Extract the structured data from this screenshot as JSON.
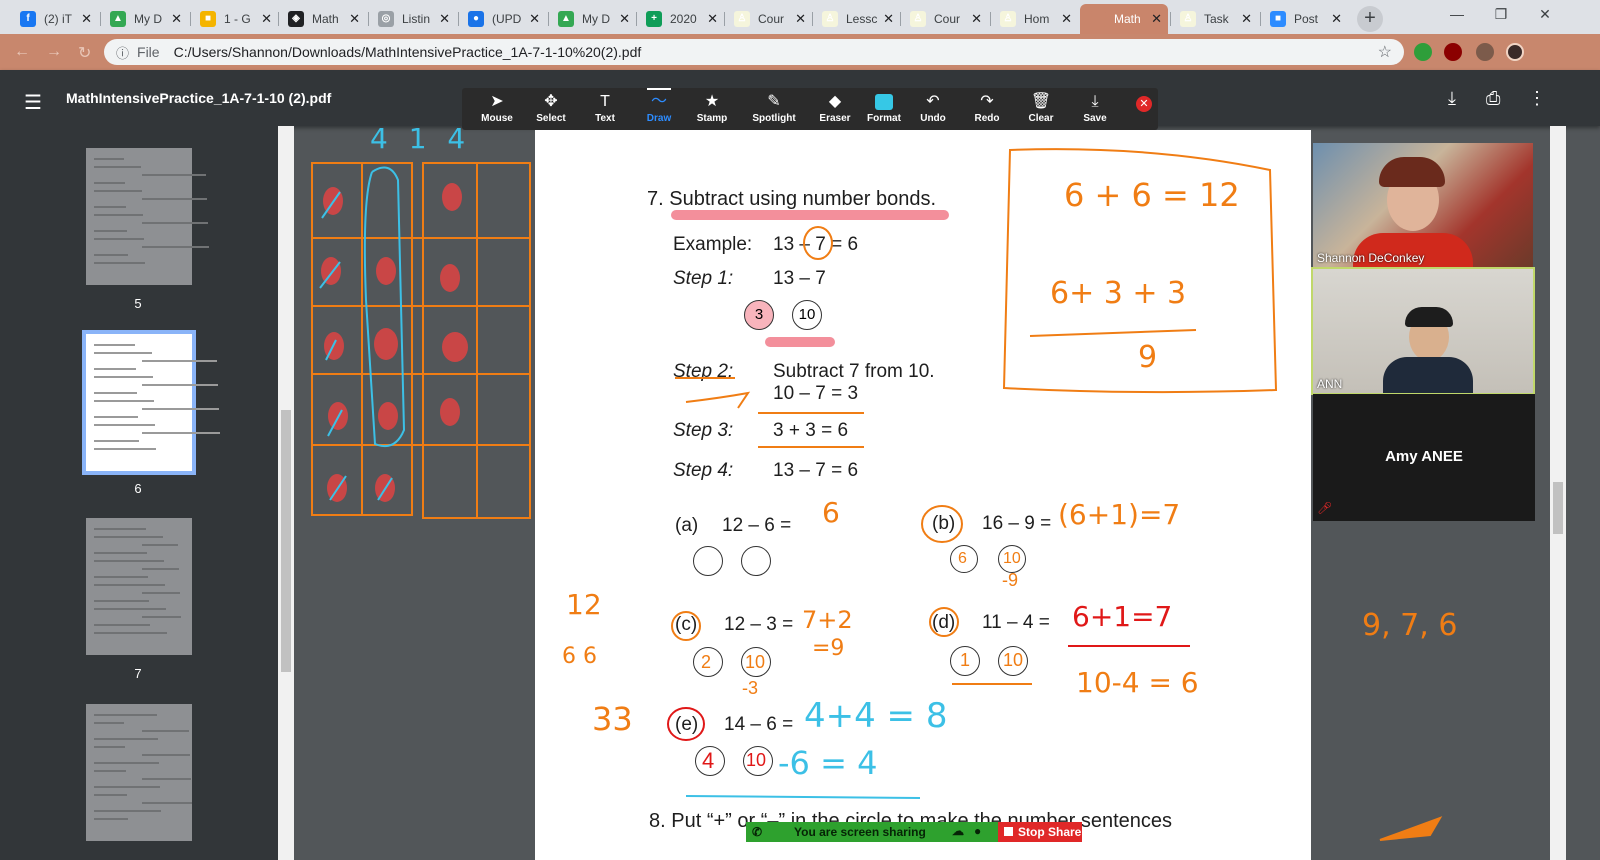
{
  "browser": {
    "tabs": [
      {
        "title": "(2) iT",
        "fav": "#1877f2",
        "glyph": "f"
      },
      {
        "title": "My D",
        "fav": "#34a853",
        "glyph": "▲"
      },
      {
        "title": "1 - G",
        "fav": "#f4b400",
        "glyph": "■"
      },
      {
        "title": "Math",
        "fav": "#202124",
        "glyph": "◈"
      },
      {
        "title": "Listin",
        "fav": "#9aa0a6",
        "glyph": "◎"
      },
      {
        "title": "(UPD",
        "fav": "#1a73e8",
        "glyph": "●"
      },
      {
        "title": "My D",
        "fav": "#34a853",
        "glyph": "▲"
      },
      {
        "title": "2020",
        "fav": "#0f9d58",
        "glyph": "+"
      },
      {
        "title": "Cour",
        "fav": "#f5f5dc",
        "glyph": "♙"
      },
      {
        "title": "Lessc",
        "fav": "#f5f5dc",
        "glyph": "♙"
      },
      {
        "title": "Cour",
        "fav": "#f5f5dc",
        "glyph": "♙"
      },
      {
        "title": "Hom",
        "fav": "#f5f5dc",
        "glyph": "♙"
      },
      {
        "title": "Math",
        "fav": "#c9856b",
        "glyph": ""
      },
      {
        "title": "Task",
        "fav": "#f5f5dc",
        "glyph": "♙"
      },
      {
        "title": "Post",
        "fav": "#2d8cff",
        "glyph": "■"
      }
    ],
    "address": {
      "scheme": "File",
      "url": "C:/Users/Shannon/Downloads/MathIntensivePractice_1A-7-1-10%20(2).pdf"
    }
  },
  "pdf": {
    "title": "MathIntensivePractice_1A-7-1-10 (2).pdf",
    "thumbs": [
      {
        "page": "5"
      },
      {
        "page": "6"
      },
      {
        "page": "7"
      },
      {
        "page": ""
      }
    ]
  },
  "annotate": {
    "tools": [
      {
        "label": "Mouse",
        "icon": "➤"
      },
      {
        "label": "Select",
        "icon": "✥"
      },
      {
        "label": "Text",
        "icon": "T"
      },
      {
        "label": "Draw",
        "icon": "〜"
      },
      {
        "label": "Stamp",
        "icon": "★"
      },
      {
        "label": "Spotlight",
        "icon": "✎"
      },
      {
        "label": "Eraser",
        "icon": "◆"
      },
      {
        "label": "Format",
        "icon": "■"
      },
      {
        "label": "Undo",
        "icon": "↶"
      },
      {
        "label": "Redo",
        "icon": "↷"
      },
      {
        "label": "Clear",
        "icon": "🗑"
      },
      {
        "label": "Save",
        "icon": "⤓"
      }
    ],
    "selected": "Draw"
  },
  "worksheet": {
    "q7_title": "7.  Subtract using number bonds.",
    "example_label": "Example:",
    "example_eq": "13 – 7 = 6",
    "step1_label": "Step 1:",
    "step1_eq": "13 – 7",
    "bond_a": "3",
    "bond_b": "10",
    "step2_label": "Step 2:",
    "step2_text": "Subtract 7 from 10.",
    "step2_eq": "10 – 7 = 3",
    "step3_label": "Step 3:",
    "step3_eq": "3 + 3 = 6",
    "step4_label": "Step 4:",
    "step4_eq": "13 – 7 = 6",
    "a_label": "(a)",
    "a_eq": "12 – 6 =",
    "b_label": "(b)",
    "b_eq": "16 – 9 =",
    "c_label": "(c)",
    "c_eq": "12 – 3 =",
    "d_label": "(d)",
    "d_eq": "11 – 4 =",
    "e_label": "(e)",
    "e_eq": "14 – 6 =",
    "q8_text": "8.  Put “+” or “–” in the circle to make the number sentences"
  },
  "handwriting": {
    "top_left": "4 1 4",
    "box_eq": "6 + 6 = 12",
    "box_split": "6+ 3 + 3",
    "box_result": "9",
    "a_ans": "6",
    "b_ans": "(6+1)=7",
    "b_bond_a": "6",
    "b_bond_b": "10",
    "b_sub": "-9",
    "c_ans": "7+2",
    "c_ans2": "=9",
    "c_bond_a": "2",
    "c_bond_b": "10",
    "c_sub": "-3",
    "d_ans": "6+1=7",
    "d_bond_a": "1",
    "d_bond_b": "10",
    "d_work": "10-4 = 6",
    "e_ans": "4+4 = 8",
    "e_bond_a": "4",
    "e_bond_b": "10",
    "e_work": "-6 = 4",
    "left_work_top": "12",
    "left_work_mid": "6   6",
    "left_work_bot": "33",
    "right_numbers": "9, 7, 6"
  },
  "zoom": {
    "participants": [
      {
        "name": "Shannon DeConkey"
      },
      {
        "name": "ANN"
      }
    ],
    "name_card": "Amy ANEE",
    "sharing_text": "You are screen sharing",
    "stop_share": "Stop Share"
  },
  "colors": {
    "orange": "#f07d14",
    "red": "#e01818",
    "cyan": "#3cc0e6",
    "pink": "#f06a7a"
  }
}
